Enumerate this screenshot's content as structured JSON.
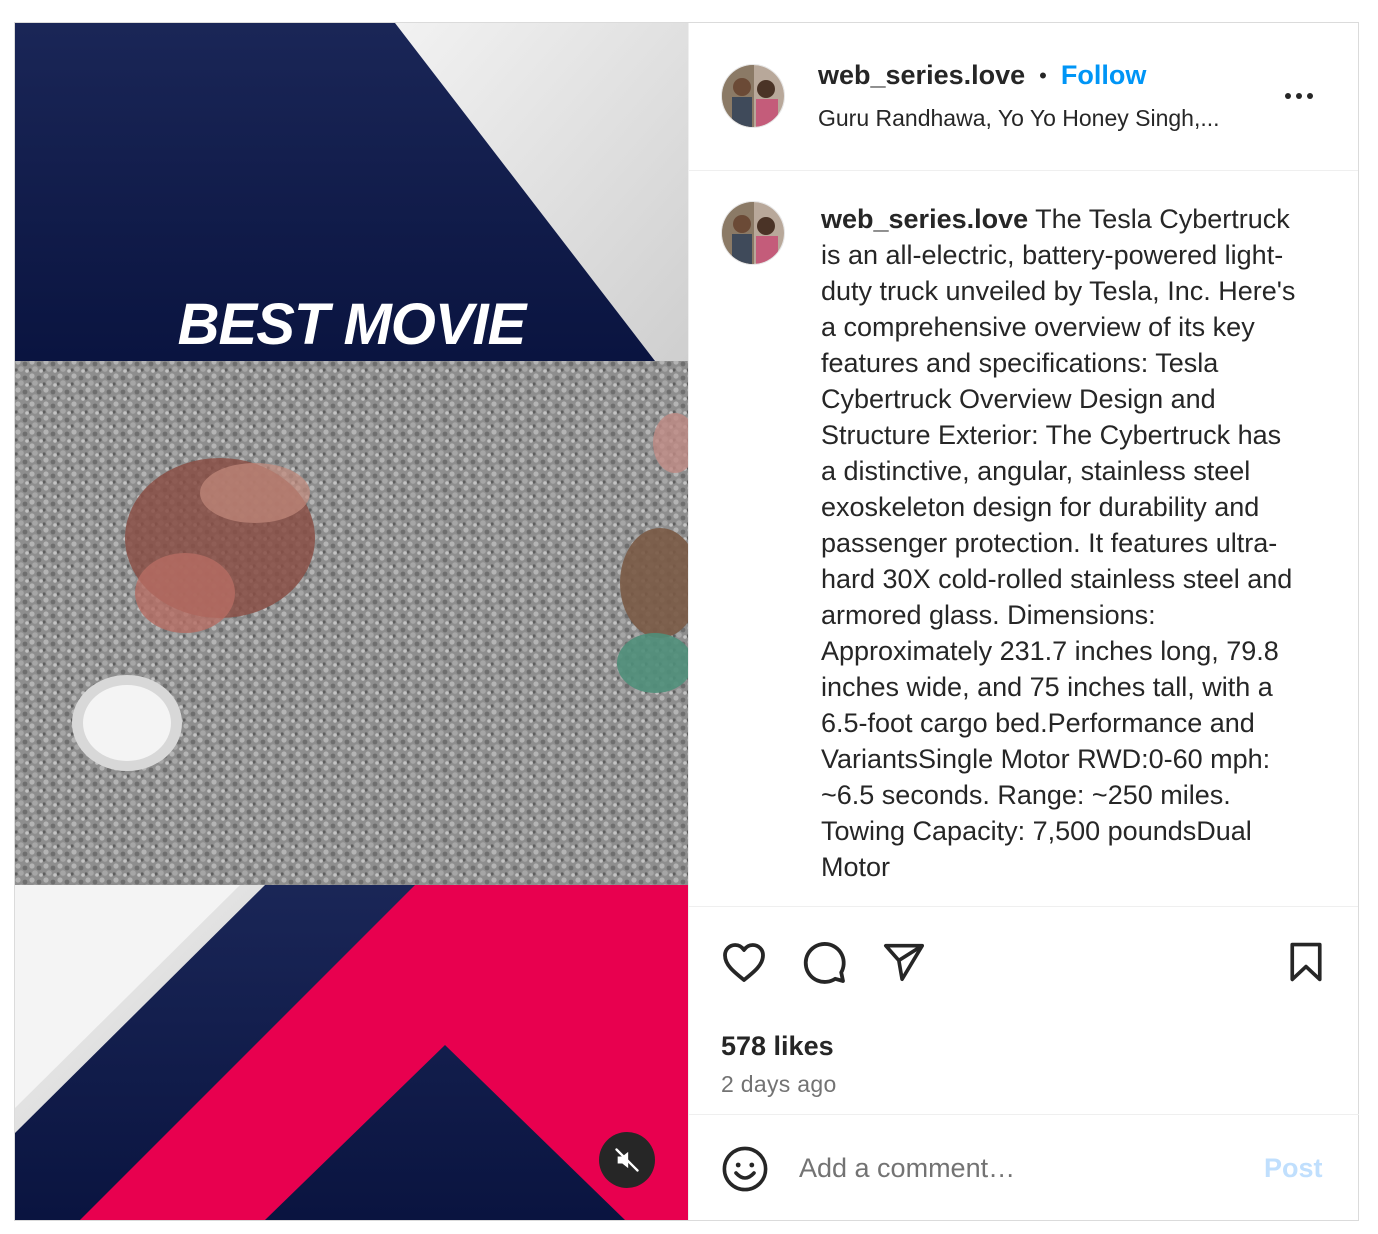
{
  "post": {
    "media": {
      "title": "BEST MOVIE",
      "mute_icon": "speaker-muted-icon",
      "colors": {
        "navy": "#0e1a47",
        "pink": "#e8004f",
        "gravel": "#8a8a8a"
      }
    },
    "header": {
      "username": "web_series.love",
      "separator": "•",
      "follow_label": "Follow",
      "audio": "Guru Randhawa, Yo Yo Honey Singh,...",
      "more_icon": "more-horizontal-icon"
    },
    "caption": {
      "username": "web_series.love",
      "text": "The Tesla Cybertruck is an all-electric, battery-powered light-duty truck unveiled by Tesla, Inc. Here's a comprehensive overview of its key features and specifications: Tesla Cybertruck Overview Design and Structure Exterior: The Cybertruck has a distinctive, angular, stainless steel exoskeleton design for durability and passenger protection. It features ultra-hard 30X cold-rolled stainless steel and armored glass. Dimensions: Approximately 231.7 inches long, 79.8 inches wide, and 75 inches tall, with a 6.5-foot cargo bed.Performance and VariantsSingle Motor RWD:0-60 mph: ~6.5 seconds. Range: ~250 miles. Towing Capacity: 7,500 poundsDual Motor"
    },
    "actions": {
      "like_icon": "heart-icon",
      "comment_icon": "comment-bubble-icon",
      "share_icon": "paper-plane-icon",
      "save_icon": "bookmark-icon"
    },
    "likes": "578 likes",
    "time_ago": "2 days ago",
    "comment": {
      "placeholder": "Add a comment…",
      "post_label": "Post",
      "emoji_icon": "smiley-icon"
    },
    "accent_color": "#0095f6"
  }
}
